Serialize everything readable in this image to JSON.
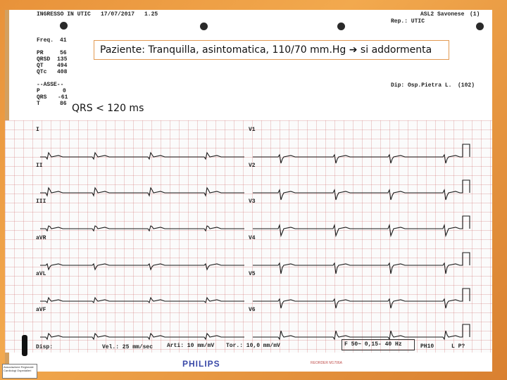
{
  "header": {
    "admission": "INGRESSO IN UTIC",
    "date": "17/07/2017",
    "time": "1.25",
    "institution": "ASL2 Savonese",
    "institution_code": "(1)",
    "department": "Rep.: UTIC",
    "facility": "Dip: Osp.Pietra L.",
    "facility_code": "(102)"
  },
  "measurements": {
    "freq_label": "Freq.",
    "freq_value": "41",
    "pr_label": "PR",
    "pr_value": "56",
    "qrsd_label": "QRSD",
    "qrsd_value": "135",
    "qt_label": "QT",
    "qt_value": "494",
    "qtc_label": "QTc",
    "qtc_value": "408",
    "axes_label": "--ASSE--",
    "p_label": "P",
    "p_value": "0",
    "qrs_label": "QRS",
    "qrs_value": "-61",
    "t_label": "T",
    "t_value": "86"
  },
  "callout": {
    "text": "Paziente: Tranquilla, asintomatica, 110/70 mm.Hg ➔ si addormenta"
  },
  "qrs_note": "QRS  < 120 ms",
  "leads": {
    "left": [
      "I",
      "II",
      "III",
      "aVR",
      "aVL",
      "aVF"
    ],
    "right": [
      "V1",
      "V2",
      "V3",
      "V4",
      "V5",
      "V6"
    ]
  },
  "footer": {
    "disp": "Disp:",
    "speed": "Vel.: 25 mm/sec",
    "limb_gain": "Arti: 10 mm/mV",
    "chest_gain": "Tor.: 10,0 mm/mV",
    "filter": "F 50~ 0,15- 40 Hz",
    "model": "PH10",
    "lp": "L P?"
  },
  "brand": "PHILIPS",
  "reorder": "REORDER M1706A",
  "badge": "Associazione Regionale Cardiologi Ospedalieri"
}
